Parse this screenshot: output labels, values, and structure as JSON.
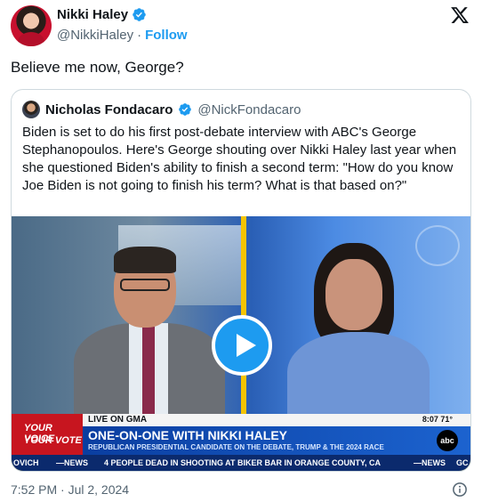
{
  "author": {
    "name": "Nikki Haley",
    "handle": "@NikkiHaley",
    "separator": "·",
    "follow_label": "Follow"
  },
  "tweet": {
    "text": "Believe me now, George?",
    "timestamp": "7:52 PM · Jul 2, 2024"
  },
  "quoted": {
    "name": "Nicholas Fondacaro",
    "handle": "@NickFondacaro",
    "text": "Biden is set to do his first post-debate interview with ABC's George Stephanopoulos. Here's George shouting over Nikki Haley last year when she questioned Biden's ability to finish a second term: \"How do you know Joe Biden is not going to finish his term? What is that based on?\""
  },
  "video": {
    "brand_line1": "YOUR VOICE",
    "brand_line2": "YOUR VOTE",
    "live_label": "LIVE ON GMA",
    "time_temp": "8:07 71°",
    "headline": "ONE-ON-ONE WITH NIKKI HALEY",
    "subheadline": "REPUBLICAN PRESIDENTIAL CANDIDATE ON THE DEBATE, TRUMP & THE 2024 RACE",
    "network_logo": "abc",
    "ticker_left": "OVICH",
    "ticker_news1": "—NEWS",
    "ticker_story": "4 PEOPLE DEAD IN SHOOTING AT BIKER BAR IN ORANGE COUNTY, CA",
    "ticker_news2": "—NEWS",
    "ticker_right": "GC"
  },
  "icons": {
    "verified": "verified-badge-icon",
    "x_logo": "x-logo-icon",
    "play": "play-icon",
    "info": "info-icon"
  },
  "colors": {
    "accent": "#1d9bf0",
    "secondary_text": "#536471",
    "border": "#cfd9de",
    "lower_third": "#0a3ea0",
    "brand_red": "#c7151f"
  }
}
